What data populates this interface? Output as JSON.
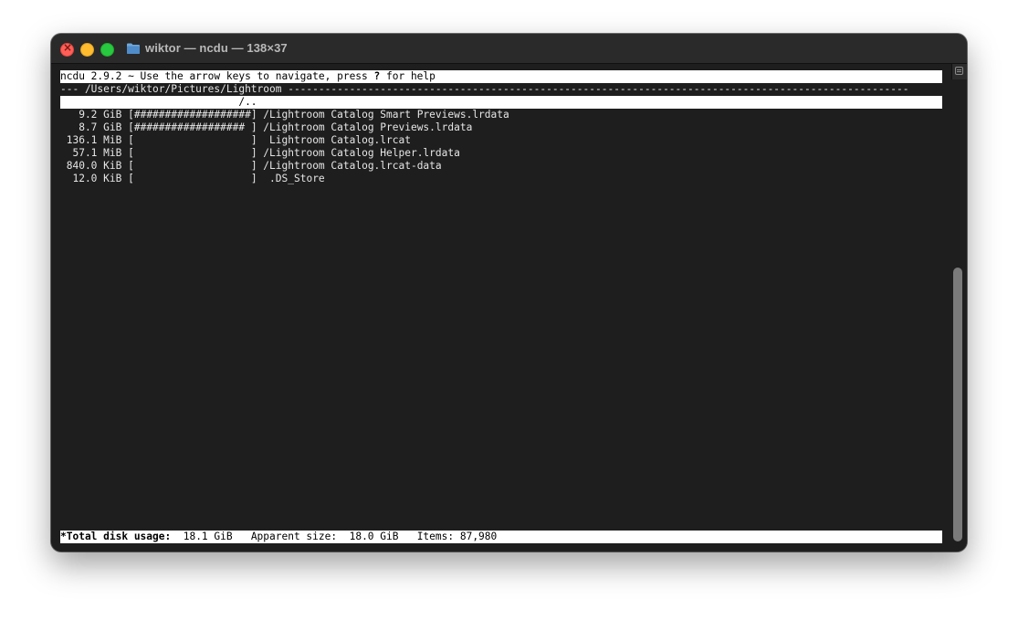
{
  "window": {
    "title": "wiktor — ncdu — 138×37",
    "folder_icon": "folder-icon"
  },
  "ncdu": {
    "header": {
      "prefix": "ncdu 2.9.2 ~ Use the arrow keys to navigate, press ",
      "help_key": "?",
      "suffix": " for help"
    },
    "path_bar": "--- /Users/wiktor/Pictures/Lightroom -----------------------------------------------------------------------------------------------------",
    "parent_row": "                             /..",
    "entries": [
      {
        "size": "   9.2 GiB",
        "bar": "[###################]",
        "flag": " /",
        "name": "Lightroom Catalog Smart Previews.lrdata"
      },
      {
        "size": "   8.7 GiB",
        "bar": "[################## ]",
        "flag": " /",
        "name": "Lightroom Catalog Previews.lrdata"
      },
      {
        "size": " 136.1 MiB",
        "bar": "[                   ]",
        "flag": "  ",
        "name": "Lightroom Catalog.lrcat"
      },
      {
        "size": "  57.1 MiB",
        "bar": "[                   ]",
        "flag": " /",
        "name": "Lightroom Catalog Helper.lrdata"
      },
      {
        "size": " 840.0 KiB",
        "bar": "[                   ]",
        "flag": " /",
        "name": "Lightroom Catalog.lrcat-data"
      },
      {
        "size": "  12.0 KiB",
        "bar": "[                   ]",
        "flag": "  ",
        "name": ".DS_Store"
      }
    ],
    "status": {
      "total_label": "*Total disk usage:",
      "total_value": "  18.1 GiB",
      "apparent_label": "   Apparent size:",
      "apparent_value": "  18.0 GiB",
      "items_label": "   Items:",
      "items_value": " 87,980"
    }
  },
  "colors": {
    "terminal_bg": "#1e1e1e",
    "terminal_fg": "#e6e6e6",
    "inverse_bg": "#ffffff",
    "inverse_fg": "#000000"
  }
}
